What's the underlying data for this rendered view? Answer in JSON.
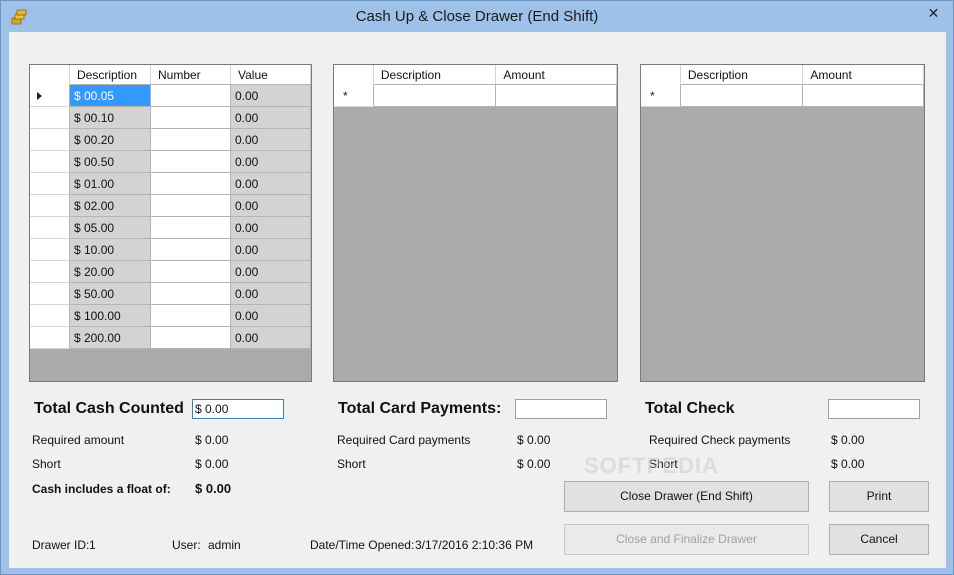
{
  "window": {
    "title": "Cash Up & Close Drawer (End Shift)",
    "close_glyph": "✕",
    "icon": "coins-icon"
  },
  "cash_grid": {
    "headers": [
      "Description",
      "Number",
      "Value"
    ],
    "rows": [
      {
        "desc": "$ 00.05",
        "num": "",
        "val": "0.00"
      },
      {
        "desc": "$ 00.10",
        "num": "",
        "val": "0.00"
      },
      {
        "desc": "$ 00.20",
        "num": "",
        "val": "0.00"
      },
      {
        "desc": "$ 00.50",
        "num": "",
        "val": "0.00"
      },
      {
        "desc": "$ 01.00",
        "num": "",
        "val": "0.00"
      },
      {
        "desc": "$ 02.00",
        "num": "",
        "val": "0.00"
      },
      {
        "desc": "$ 05.00",
        "num": "",
        "val": "0.00"
      },
      {
        "desc": "$ 10.00",
        "num": "",
        "val": "0.00"
      },
      {
        "desc": "$ 20.00",
        "num": "",
        "val": "0.00"
      },
      {
        "desc": "$ 50.00",
        "num": "",
        "val": "0.00"
      },
      {
        "desc": "$ 100.00",
        "num": "",
        "val": "0.00"
      },
      {
        "desc": "$ 200.00",
        "num": "",
        "val": "0.00"
      }
    ]
  },
  "card_grid": {
    "headers": [
      "Description",
      "Amount"
    ],
    "new_row_glyph": "*"
  },
  "check_grid": {
    "headers": [
      "Description",
      "Amount"
    ],
    "new_row_glyph": "*"
  },
  "cash": {
    "total_label": "Total Cash Counted",
    "total_value": "$ 0.00",
    "required_label": "Required amount",
    "required_value": "$ 0.00",
    "short_label": "Short",
    "short_value": "$ 0.00",
    "float_label": "Cash includes a float of:",
    "float_value": "$ 0.00"
  },
  "card": {
    "total_label": "Total Card Payments:",
    "total_value": "",
    "required_label": "Required Card payments",
    "required_value": "$ 0.00",
    "short_label": "Short",
    "short_value": "$ 0.00"
  },
  "check": {
    "total_label": "Total Check",
    "total_value": "",
    "required_label": "Required Check payments",
    "required_value": "$ 0.00",
    "short_label": "Short",
    "short_value": "$ 0.00"
  },
  "footer": {
    "drawer_label": "Drawer ID:",
    "drawer_value": "1",
    "user_label": "User:",
    "user_value": "admin",
    "opened_label": "Date/Time Opened:",
    "opened_value": "3/17/2016 2:10:36 PM"
  },
  "buttons": {
    "close_drawer": "Close Drawer (End Shift)",
    "print": "Print",
    "finalize": "Close and Finalize Drawer",
    "cancel": "Cancel"
  },
  "watermark": "SOFTPEDIA"
}
